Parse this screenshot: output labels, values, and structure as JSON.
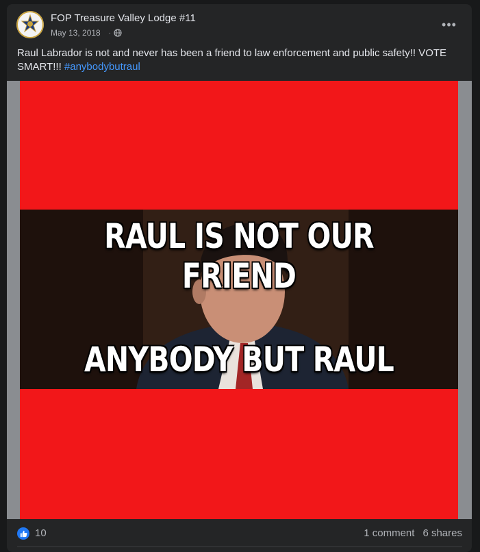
{
  "post": {
    "page_name": "FOP Treasure Valley Lodge #11",
    "date": "May 13, 2018",
    "separator": "·",
    "privacy_icon": "globe-icon",
    "more_icon": "more-options-icon",
    "more_label": "•••",
    "text": "Raul Labrador is not and never has been a friend to law enforcement and public safety!!  VOTE SMART!!! ",
    "hashtag": "#anybodybutraul"
  },
  "media": {
    "top_caption": "RAUL IS NOT OUR FRIEND",
    "bottom_caption": "ANYBODY BUT RAUL",
    "background_color": "#f21719"
  },
  "footer": {
    "reaction_icon": "thumbs-up-icon",
    "like_count": "10",
    "comments": "1 comment",
    "shares": "6 shares"
  },
  "colors": {
    "card": "#242526",
    "accent": "#2078f4",
    "hashtag": "#4599ff"
  }
}
